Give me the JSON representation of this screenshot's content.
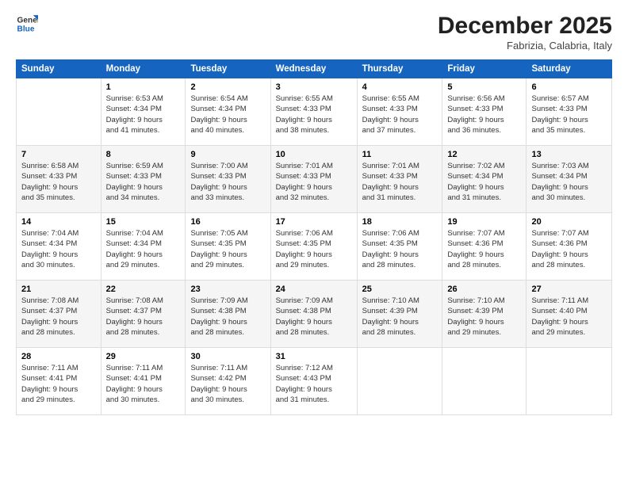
{
  "header": {
    "logo_general": "General",
    "logo_blue": "Blue",
    "month_title": "December 2025",
    "location": "Fabrizia, Calabria, Italy"
  },
  "weekdays": [
    "Sunday",
    "Monday",
    "Tuesday",
    "Wednesday",
    "Thursday",
    "Friday",
    "Saturday"
  ],
  "weeks": [
    [
      {
        "day": "",
        "info": ""
      },
      {
        "day": "1",
        "info": "Sunrise: 6:53 AM\nSunset: 4:34 PM\nDaylight: 9 hours\nand 41 minutes."
      },
      {
        "day": "2",
        "info": "Sunrise: 6:54 AM\nSunset: 4:34 PM\nDaylight: 9 hours\nand 40 minutes."
      },
      {
        "day": "3",
        "info": "Sunrise: 6:55 AM\nSunset: 4:33 PM\nDaylight: 9 hours\nand 38 minutes."
      },
      {
        "day": "4",
        "info": "Sunrise: 6:55 AM\nSunset: 4:33 PM\nDaylight: 9 hours\nand 37 minutes."
      },
      {
        "day": "5",
        "info": "Sunrise: 6:56 AM\nSunset: 4:33 PM\nDaylight: 9 hours\nand 36 minutes."
      },
      {
        "day": "6",
        "info": "Sunrise: 6:57 AM\nSunset: 4:33 PM\nDaylight: 9 hours\nand 35 minutes."
      }
    ],
    [
      {
        "day": "7",
        "info": "Sunrise: 6:58 AM\nSunset: 4:33 PM\nDaylight: 9 hours\nand 35 minutes."
      },
      {
        "day": "8",
        "info": "Sunrise: 6:59 AM\nSunset: 4:33 PM\nDaylight: 9 hours\nand 34 minutes."
      },
      {
        "day": "9",
        "info": "Sunrise: 7:00 AM\nSunset: 4:33 PM\nDaylight: 9 hours\nand 33 minutes."
      },
      {
        "day": "10",
        "info": "Sunrise: 7:01 AM\nSunset: 4:33 PM\nDaylight: 9 hours\nand 32 minutes."
      },
      {
        "day": "11",
        "info": "Sunrise: 7:01 AM\nSunset: 4:33 PM\nDaylight: 9 hours\nand 31 minutes."
      },
      {
        "day": "12",
        "info": "Sunrise: 7:02 AM\nSunset: 4:34 PM\nDaylight: 9 hours\nand 31 minutes."
      },
      {
        "day": "13",
        "info": "Sunrise: 7:03 AM\nSunset: 4:34 PM\nDaylight: 9 hours\nand 30 minutes."
      }
    ],
    [
      {
        "day": "14",
        "info": "Sunrise: 7:04 AM\nSunset: 4:34 PM\nDaylight: 9 hours\nand 30 minutes."
      },
      {
        "day": "15",
        "info": "Sunrise: 7:04 AM\nSunset: 4:34 PM\nDaylight: 9 hours\nand 29 minutes."
      },
      {
        "day": "16",
        "info": "Sunrise: 7:05 AM\nSunset: 4:35 PM\nDaylight: 9 hours\nand 29 minutes."
      },
      {
        "day": "17",
        "info": "Sunrise: 7:06 AM\nSunset: 4:35 PM\nDaylight: 9 hours\nand 29 minutes."
      },
      {
        "day": "18",
        "info": "Sunrise: 7:06 AM\nSunset: 4:35 PM\nDaylight: 9 hours\nand 28 minutes."
      },
      {
        "day": "19",
        "info": "Sunrise: 7:07 AM\nSunset: 4:36 PM\nDaylight: 9 hours\nand 28 minutes."
      },
      {
        "day": "20",
        "info": "Sunrise: 7:07 AM\nSunset: 4:36 PM\nDaylight: 9 hours\nand 28 minutes."
      }
    ],
    [
      {
        "day": "21",
        "info": "Sunrise: 7:08 AM\nSunset: 4:37 PM\nDaylight: 9 hours\nand 28 minutes."
      },
      {
        "day": "22",
        "info": "Sunrise: 7:08 AM\nSunset: 4:37 PM\nDaylight: 9 hours\nand 28 minutes."
      },
      {
        "day": "23",
        "info": "Sunrise: 7:09 AM\nSunset: 4:38 PM\nDaylight: 9 hours\nand 28 minutes."
      },
      {
        "day": "24",
        "info": "Sunrise: 7:09 AM\nSunset: 4:38 PM\nDaylight: 9 hours\nand 28 minutes."
      },
      {
        "day": "25",
        "info": "Sunrise: 7:10 AM\nSunset: 4:39 PM\nDaylight: 9 hours\nand 28 minutes."
      },
      {
        "day": "26",
        "info": "Sunrise: 7:10 AM\nSunset: 4:39 PM\nDaylight: 9 hours\nand 29 minutes."
      },
      {
        "day": "27",
        "info": "Sunrise: 7:11 AM\nSunset: 4:40 PM\nDaylight: 9 hours\nand 29 minutes."
      }
    ],
    [
      {
        "day": "28",
        "info": "Sunrise: 7:11 AM\nSunset: 4:41 PM\nDaylight: 9 hours\nand 29 minutes."
      },
      {
        "day": "29",
        "info": "Sunrise: 7:11 AM\nSunset: 4:41 PM\nDaylight: 9 hours\nand 30 minutes."
      },
      {
        "day": "30",
        "info": "Sunrise: 7:11 AM\nSunset: 4:42 PM\nDaylight: 9 hours\nand 30 minutes."
      },
      {
        "day": "31",
        "info": "Sunrise: 7:12 AM\nSunset: 4:43 PM\nDaylight: 9 hours\nand 31 minutes."
      },
      {
        "day": "",
        "info": ""
      },
      {
        "day": "",
        "info": ""
      },
      {
        "day": "",
        "info": ""
      }
    ]
  ]
}
